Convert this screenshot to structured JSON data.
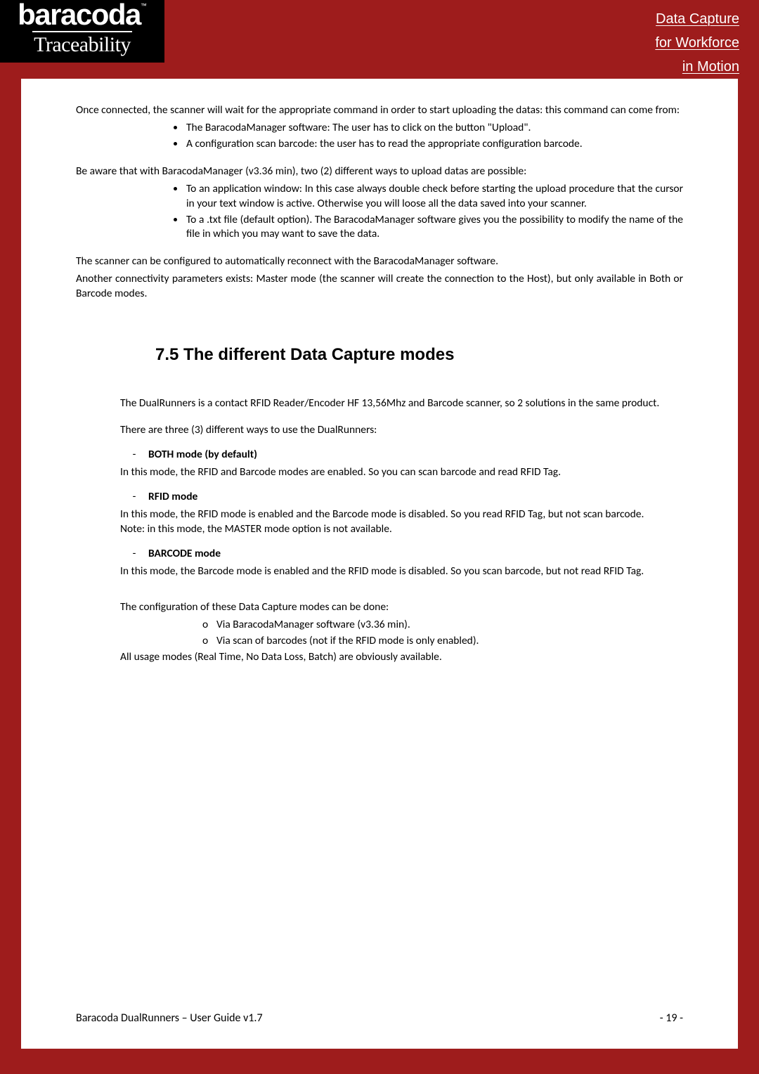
{
  "header": {
    "logo_top": "baracoda",
    "logo_tm": "™",
    "logo_bottom": "Traceability",
    "tagline_l1": "Data Capture",
    "tagline_l2": "for Workforce",
    "tagline_l3": "in Motion"
  },
  "body": {
    "p1": "Once connected, the scanner will wait for the appropriate command in order to start uploading the datas: this command can come from:",
    "b1_1": "The BaracodaManager software: The user has to click on the button \"Upload\".",
    "b1_2": "A configuration scan barcode: the user has to read the appropriate configuration barcode.",
    "p2": "Be aware that with BaracodaManager (v3.36 min), two (2) different ways to upload datas are possible:",
    "b2_1": "To an application window: In this case always double check before starting the upload procedure that the cursor in your text window is active. Otherwise you will loose all the data saved into your scanner.",
    "b2_2": "To a .txt file (default option). The BaracodaManager software gives you the possibility to modify the name of the file in which you may want to save the data.",
    "p3": "The scanner can be configured to automatically reconnect with the BaracodaManager software.",
    "p4": "Another connectivity parameters exists: Master mode (the scanner will create the connection to the Host), but only available in Both or Barcode modes.",
    "heading": "7.5 The different Data Capture modes",
    "p5": "The DualRunners is a contact RFID Reader/Encoder HF 13,56Mhz and Barcode scanner, so 2 solutions in the same product.",
    "p6": "There are three (3) different ways to use the DualRunners:",
    "mode1_dash": "-",
    "mode1_title": "BOTH mode (by default)",
    "mode1_text": "In this mode, the RFID and Barcode modes are enabled. So you can scan barcode and read RFID Tag.",
    "mode2_dash": "-",
    "mode2_title": "RFID mode",
    "mode2_text": "In this mode, the RFID mode is enabled and the Barcode mode is disabled. So you read RFID Tag, but not scan barcode.",
    "mode2_note": "Note: in this mode, the MASTER mode option is not available.",
    "mode3_dash": "-",
    "mode3_title": "BARCODE mode",
    "mode3_text": "In this mode, the Barcode mode is enabled and the RFID mode is disabled. So you scan barcode, but not read RFID Tag.",
    "p7": " The configuration of these Data Capture modes can be done:",
    "sb1_c": "o",
    "sb1": "Via BaracodaManager software (v3.36 min).",
    "sb2_c": "o",
    "sb2": "Via scan of barcodes (not if the RFID mode is only enabled).",
    "p8": "All usage modes (Real Time, No Data Loss, Batch) are obviously available."
  },
  "footer": {
    "left": "Baracoda DualRunners – User Guide v1.7",
    "right": "- 19 -"
  }
}
